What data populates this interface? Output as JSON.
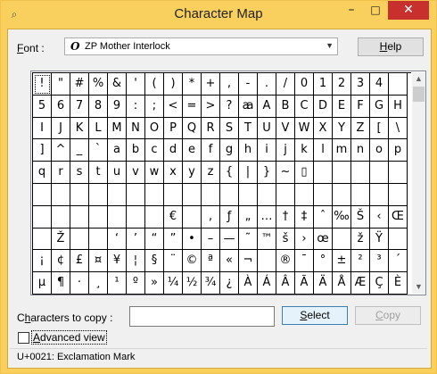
{
  "window": {
    "title": "Character Map",
    "icon": "app-icon",
    "controls": {
      "minimize": "–",
      "maximize": "□",
      "close": "✕"
    }
  },
  "font": {
    "label_prefix": "",
    "label_underlined": "F",
    "label_rest": "ont :",
    "value": "ZP Mother Interlock",
    "icon_glyph": "O"
  },
  "help_button": {
    "underlined": "H",
    "rest": "elp"
  },
  "grid": {
    "selected_index": 0,
    "rows": [
      [
        "!",
        "\"",
        "#",
        "%",
        "&",
        "'",
        "(",
        ")",
        "*",
        "+",
        ",",
        "-",
        ".",
        "/",
        "0",
        "1",
        "2",
        "3",
        "4"
      ],
      [
        "5",
        "6",
        "7",
        "8",
        "9",
        ":",
        ";",
        "<",
        "=",
        ">",
        "?",
        "ꜳ",
        "A",
        "B",
        "C",
        "D",
        "E",
        "F",
        "G",
        "H"
      ],
      [
        "I",
        "J",
        "K",
        "L",
        "M",
        "N",
        "O",
        "P",
        "Q",
        "R",
        "S",
        "T",
        "U",
        "V",
        "W",
        "X",
        "Y",
        "Z",
        "[",
        "\\"
      ],
      [
        "]",
        "^",
        "_",
        "`",
        "a",
        "b",
        "c",
        "d",
        "e",
        "f",
        "g",
        "h",
        "i",
        "j",
        "k",
        "l",
        "m",
        "n",
        "o",
        "p"
      ],
      [
        "q",
        "r",
        "s",
        "t",
        "u",
        "v",
        "w",
        "x",
        "y",
        "z",
        "{",
        "|",
        "}",
        "~",
        "▯",
        "",
        "",
        "",
        "",
        ""
      ],
      [
        "",
        "",
        "",
        "",
        "",
        "",
        "",
        "",
        "",
        "",
        "",
        "",
        "",
        "",
        "",
        "",
        "",
        "",
        "",
        ""
      ],
      [
        "",
        "",
        "",
        "",
        "",
        "",
        "",
        "€",
        "",
        "‚",
        "ƒ",
        "„",
        "…",
        "†",
        "‡",
        "ˆ",
        "‰",
        "Š",
        "‹",
        "Œ"
      ],
      [
        "",
        "Ž",
        "",
        "",
        "‘",
        "’",
        "“",
        "”",
        "•",
        "–",
        "—",
        "˜",
        "™",
        "š",
        "›",
        "œ",
        "",
        "ž",
        "Ÿ",
        ""
      ],
      [
        "¡",
        "¢",
        "£",
        "¤",
        "¥",
        "¦",
        "§",
        "¨",
        "©",
        "ª",
        "«",
        "¬",
        "",
        "®",
        "¯",
        "°",
        "±",
        "²",
        "³",
        "´"
      ],
      [
        "µ",
        "¶",
        "·",
        "¸",
        "¹",
        "º",
        "»",
        "¼",
        "½",
        "¾",
        "¿",
        "À",
        "Á",
        "Â",
        "Ã",
        "Ä",
        "Å",
        "Æ",
        "Ç",
        "È"
      ]
    ]
  },
  "copy": {
    "label_prefix": "C",
    "label_underlined": "h",
    "label_rest": "aracters to copy :",
    "value": "",
    "select_underlined": "S",
    "select_rest": "elect",
    "copy_underlined": "C",
    "copy_rest": "opy"
  },
  "advanced": {
    "checked": false,
    "underlined": "A",
    "rest": "dvanced view"
  },
  "status": {
    "text": "U+0021: Exclamation Mark"
  },
  "colors": {
    "titlebar": "#f9cf5e",
    "close_button": "#c7302d",
    "panel": "#f0f0f0"
  }
}
